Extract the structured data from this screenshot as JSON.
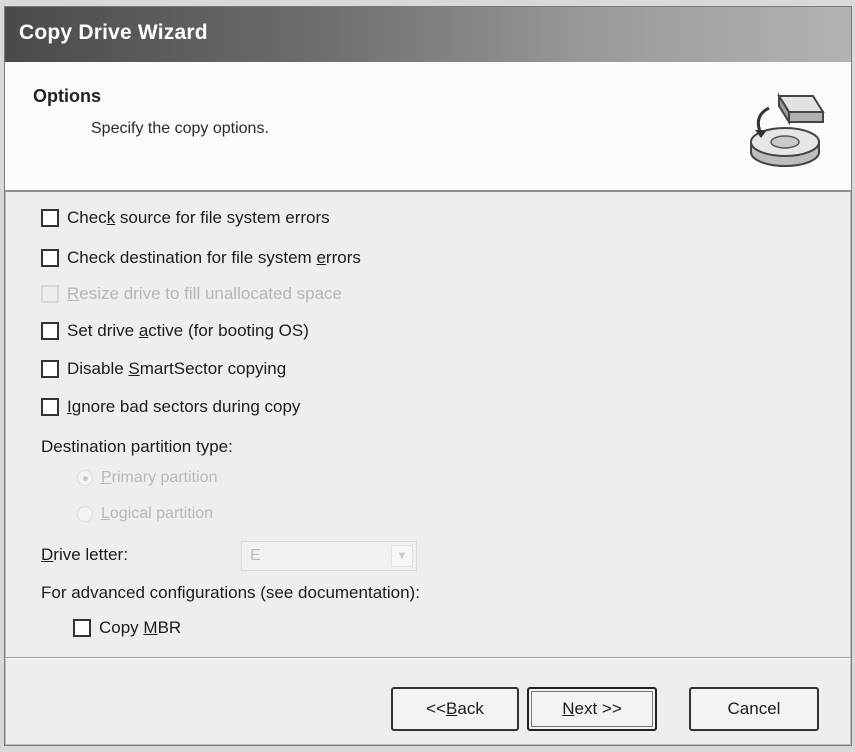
{
  "window": {
    "title": "Copy Drive Wizard"
  },
  "header": {
    "title": "Options",
    "subtitle": "Specify the copy options.",
    "icon": "copy-drive-icon"
  },
  "options": [
    {
      "pre": "Chec",
      "accel": "k",
      "post": " source for file system errors",
      "checked": false,
      "enabled": true
    },
    {
      "pre": "Check destination for file system ",
      "accel": "e",
      "post": "rrors",
      "checked": false,
      "enabled": true
    },
    {
      "pre": "",
      "accel": "R",
      "post": "esize drive to fill unallocated space",
      "checked": false,
      "enabled": false
    },
    {
      "pre": "Set drive ",
      "accel": "a",
      "post": "ctive (for booting OS)",
      "checked": false,
      "enabled": true
    },
    {
      "pre": "Disable ",
      "accel": "S",
      "post": "martSector copying",
      "checked": false,
      "enabled": true
    },
    {
      "pre": "",
      "accel": "I",
      "post": "gnore bad sectors during copy",
      "checked": false,
      "enabled": true
    }
  ],
  "partition": {
    "label": "Destination partition type:",
    "primary": {
      "accel": "P",
      "rest": "rimary partition",
      "selected": true,
      "enabled": false
    },
    "logical": {
      "accel": "L",
      "rest": "ogical partition",
      "selected": false,
      "enabled": false
    }
  },
  "drive_letter": {
    "label_accel": "D",
    "label_rest": "rive letter:",
    "value": "E",
    "enabled": false
  },
  "advanced": {
    "label": "For advanced configurations (see documentation):",
    "copy_mbr": {
      "pre": "Copy ",
      "accel": "M",
      "post": "BR",
      "checked": false
    }
  },
  "buttons": {
    "back": {
      "pre": "<< ",
      "accel": "B",
      "post": "ack"
    },
    "next": {
      "pre": "",
      "accel": "N",
      "post": "ext >>"
    },
    "cancel": "Cancel"
  }
}
